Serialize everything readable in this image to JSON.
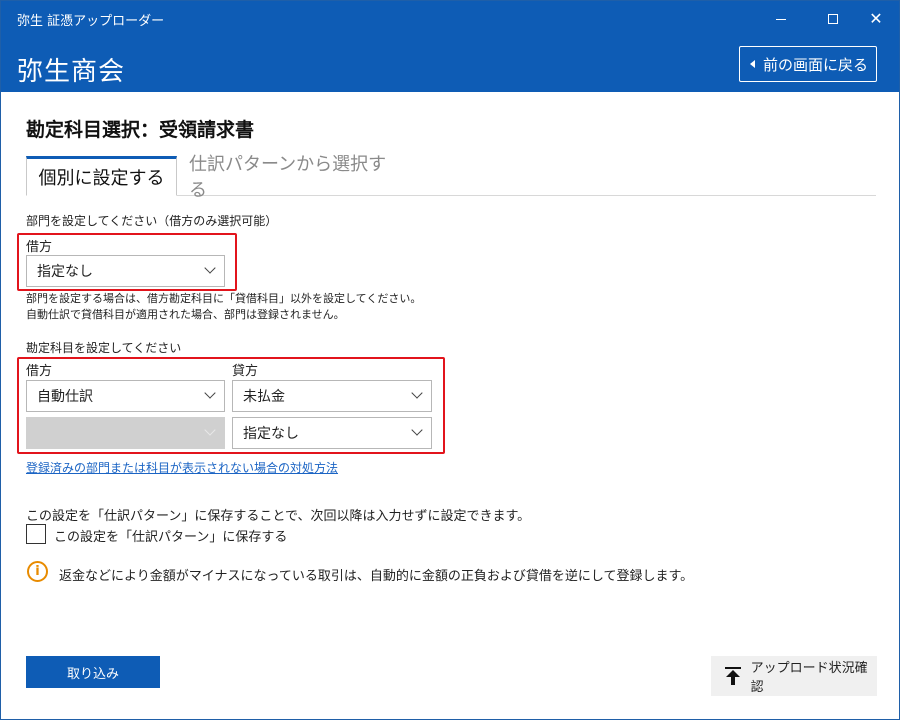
{
  "window": {
    "title": "弥生 証憑アップローダー",
    "minimize_icon": "minimize-icon",
    "maximize_icon": "maximize-icon",
    "close_icon": "close-icon"
  },
  "header": {
    "company_name": "弥生商会",
    "back_button_label": "前の画面に戻る",
    "back_icon": "caret-left-icon",
    "accent_color": "#0e5cb5"
  },
  "page": {
    "title": "勘定科目選択：受領請求書"
  },
  "tabs": [
    {
      "label": "個別に設定する",
      "active": true
    },
    {
      "label": "仕訳パターンから選択する",
      "active": false
    }
  ],
  "department": {
    "heading": "部門を設定してください（借方のみ選択可能）",
    "debit_label": "借方",
    "debit_value": "指定なし",
    "note_line1": "部門を設定する場合は、借方勘定科目に「貸借科目」以外を設定してください。",
    "note_line2": "自動仕訳で貸借科目が適用された場合、部門は登録されません。"
  },
  "accounts": {
    "heading": "勘定科目を設定してください",
    "debit_label": "借方",
    "credit_label": "貸方",
    "debit_row1": "自動仕訳",
    "debit_row2": "",
    "credit_row1": "未払金",
    "credit_row2": "指定なし"
  },
  "help_link": "登録済みの部門または科目が表示されない場合の対処方法",
  "save_pattern": {
    "description": "この設定を「仕訳パターン」に保存することで、次回以降は入力せずに設定できます。",
    "checkbox_label": "この設定を「仕訳パターン」に保存する",
    "checked": false
  },
  "info": {
    "icon": "info-icon",
    "text": "返金などにより金額がマイナスになっている取引は、自動的に金額の正負および貸借を逆にして登録します。",
    "icon_color": "#e88b00"
  },
  "footer": {
    "import_button": "取り込み",
    "status_button": "アップロード状況確認",
    "status_icon": "upload-icon"
  },
  "highlight_color": "#e2141c"
}
